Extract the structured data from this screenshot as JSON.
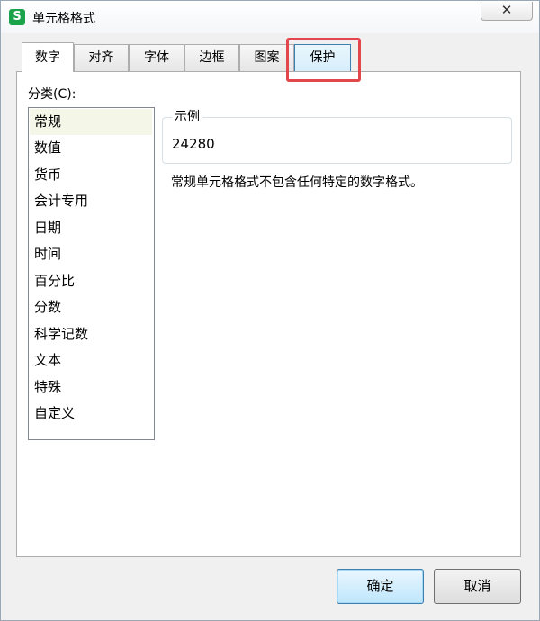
{
  "window": {
    "title": "单元格格式",
    "app_icon": "S",
    "close_symbol": "✕"
  },
  "tabs": [
    {
      "label": "数字",
      "active": true
    },
    {
      "label": "对齐",
      "active": false
    },
    {
      "label": "字体",
      "active": false
    },
    {
      "label": "边框",
      "active": false
    },
    {
      "label": "图案",
      "active": false
    },
    {
      "label": "保护",
      "active": false,
      "highlighted": true
    }
  ],
  "number_tab": {
    "category_label": "分类(C):",
    "categories": [
      "常规",
      "数值",
      "货币",
      "会计专用",
      "日期",
      "时间",
      "百分比",
      "分数",
      "科学记数",
      "文本",
      "特殊",
      "自定义"
    ],
    "selected_category": "常规",
    "sample_legend": "示例",
    "sample_value": "24280",
    "description": "常规单元格格式不包含任何特定的数字格式。"
  },
  "buttons": {
    "ok": "确定",
    "cancel": "取消"
  },
  "colors": {
    "highlight_box": "#e2474b",
    "app_icon": "#1aa34a",
    "selected_item_bg": "#f4f7e8"
  }
}
